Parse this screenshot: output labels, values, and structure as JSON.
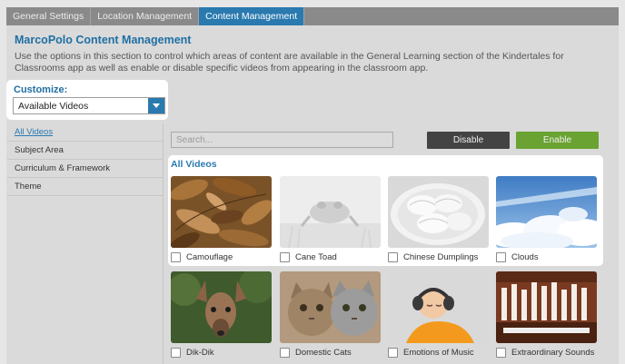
{
  "tabs": [
    "General Settings",
    "Location Management",
    "Content Management"
  ],
  "active_tab": "Content Management",
  "page": {
    "title": "MarcoPolo Content Management",
    "description": "Use the options in this section to control which areas of content are available in the General Learning section of the Kindertales for Classrooms app as well as enable or disable specific videos from appearing in the classroom app."
  },
  "customize": {
    "label": "Customize:",
    "selected": "Available Videos"
  },
  "sidebar": {
    "items": [
      "All Videos",
      "Subject Area",
      "Curriculum & Framework",
      "Theme"
    ]
  },
  "search": {
    "placeholder": "Search..."
  },
  "buttons": {
    "disable": "Disable",
    "enable": "Enable"
  },
  "section_title": "All Videos",
  "videos": [
    {
      "title": "Camouflage",
      "thumb": "camouflage-leaves-image"
    },
    {
      "title": "Cane Toad",
      "thumb": "cane-toad-image"
    },
    {
      "title": "Chinese Dumplings",
      "thumb": "chinese-dumplings-image"
    },
    {
      "title": "Clouds",
      "thumb": "clouds-sky-image"
    },
    {
      "title": "Dik-Dik",
      "thumb": "dik-dik-image"
    },
    {
      "title": "Domestic Cats",
      "thumb": "domestic-cats-image"
    },
    {
      "title": "Emotions of Music",
      "thumb": "boy-headphones-image"
    },
    {
      "title": "Extraordinary Sounds",
      "thumb": "pipe-organ-image"
    }
  ],
  "colors": {
    "accent": "#2a7ab0",
    "enable_button": "#6aa332",
    "disable_button": "#434343",
    "tab_bar": "#8a8a8a",
    "panel_bg": "#dadada"
  },
  "icons": {
    "dropdown": "chevron-down-icon"
  }
}
